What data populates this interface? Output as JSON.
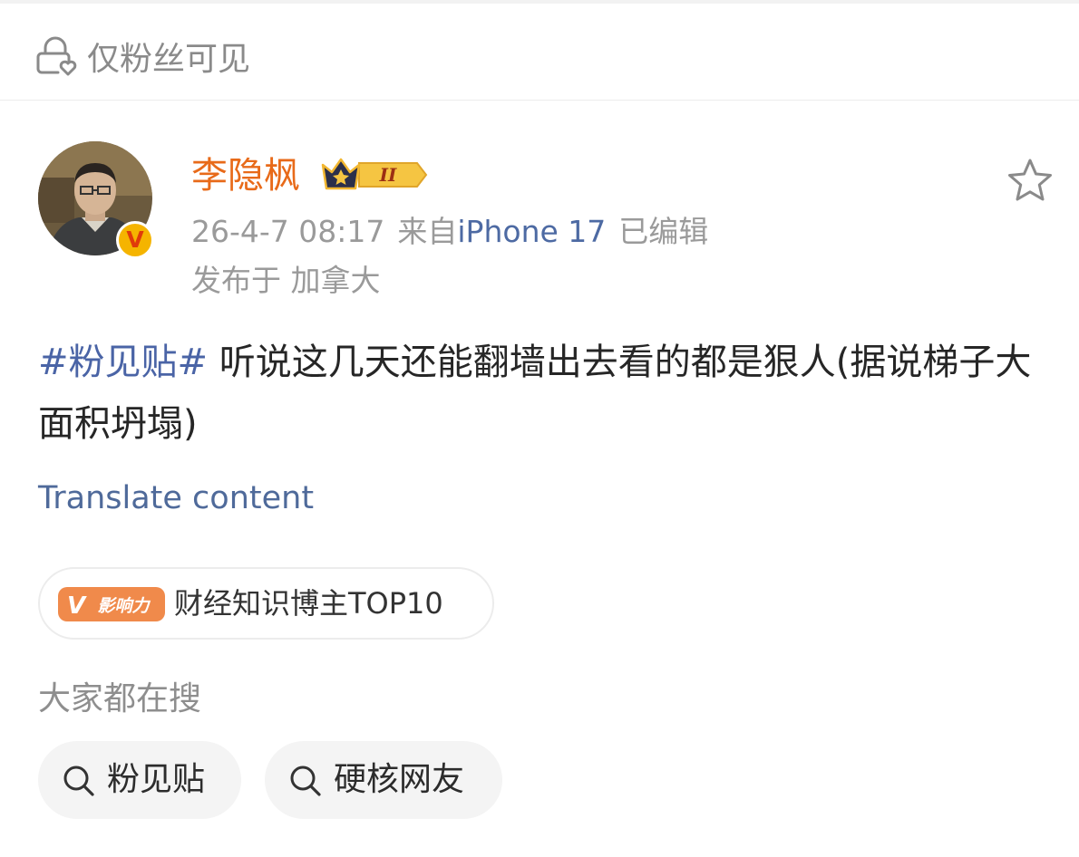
{
  "visibility": {
    "icon": "lock-heart-icon",
    "label": "仅粉丝可见"
  },
  "author": {
    "name": "李隐枫",
    "verified_badge": "V",
    "level_badge": "II",
    "name_color": "#e86a19"
  },
  "meta": {
    "time": "26-4-7 08:17",
    "source_prefix": "来自",
    "device": "iPhone 17",
    "edited": "已编辑",
    "location": "发布于 加拿大"
  },
  "post": {
    "topic": "#粉见贴#",
    "text": " 听说这几天还能翻墙出去看的都是狠人(据说梯子大面积坍塌)",
    "translate_label": "Translate content"
  },
  "influence": {
    "badge_text": "影响力",
    "badge_v": "V",
    "label": "财经知识博主TOP10"
  },
  "search": {
    "heading": "大家都在搜",
    "items": [
      {
        "label": "粉见贴",
        "icon": "search-icon"
      },
      {
        "label": "硬核网友",
        "icon": "search-icon"
      }
    ]
  },
  "colors": {
    "link_blue": "#4a64a6",
    "influence_orange": "#f08a4b",
    "verified_gold": "#f5b400"
  }
}
